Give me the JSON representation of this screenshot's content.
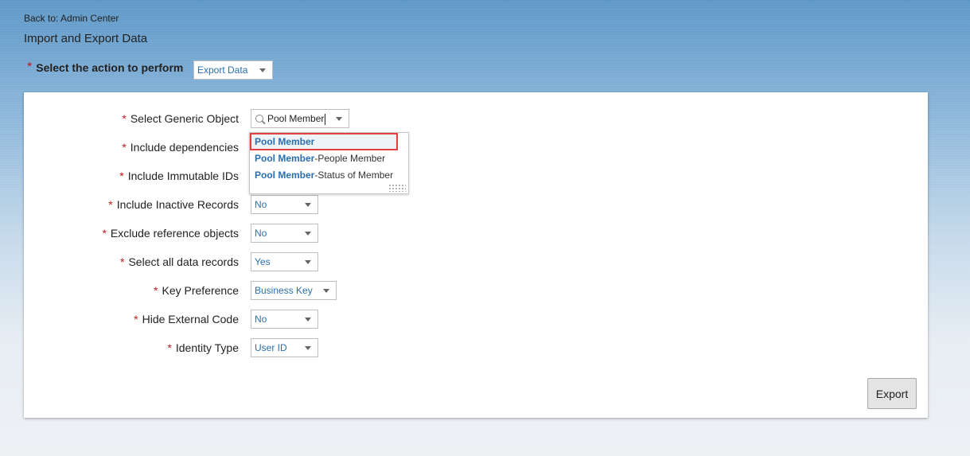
{
  "nav": {
    "back_link": "Back to: Admin Center"
  },
  "page": {
    "title": "Import and Export Data"
  },
  "action": {
    "required_mark": "*",
    "label": "Select the action to perform",
    "value": "Export Data"
  },
  "form": {
    "generic_object": {
      "label": "Select Generic Object",
      "search_value": "Pool Member"
    },
    "fields": [
      {
        "label": "Include dependencies",
        "value": ""
      },
      {
        "label": "Include Immutable IDs",
        "value": ""
      },
      {
        "label": "Include Inactive Records",
        "value": "No"
      },
      {
        "label": "Exclude reference objects",
        "value": "No"
      },
      {
        "label": "Select all data records",
        "value": "Yes"
      },
      {
        "label": "Key Preference",
        "value": "Business Key"
      },
      {
        "label": "Hide External Code",
        "value": "No"
      },
      {
        "label": "Identity Type",
        "value": "User ID"
      }
    ],
    "required_mark": "*"
  },
  "dropdown": {
    "items": [
      {
        "match": "Pool Member",
        "suffix": ""
      },
      {
        "match": "Pool Member",
        "suffix": "-People Member"
      },
      {
        "match": "Pool Member",
        "suffix": "-Status of Member"
      }
    ]
  },
  "buttons": {
    "export": "Export"
  },
  "colors": {
    "required": "#c0171d",
    "link_blue": "#2a6eb0",
    "highlight_border": "#e0403e"
  }
}
